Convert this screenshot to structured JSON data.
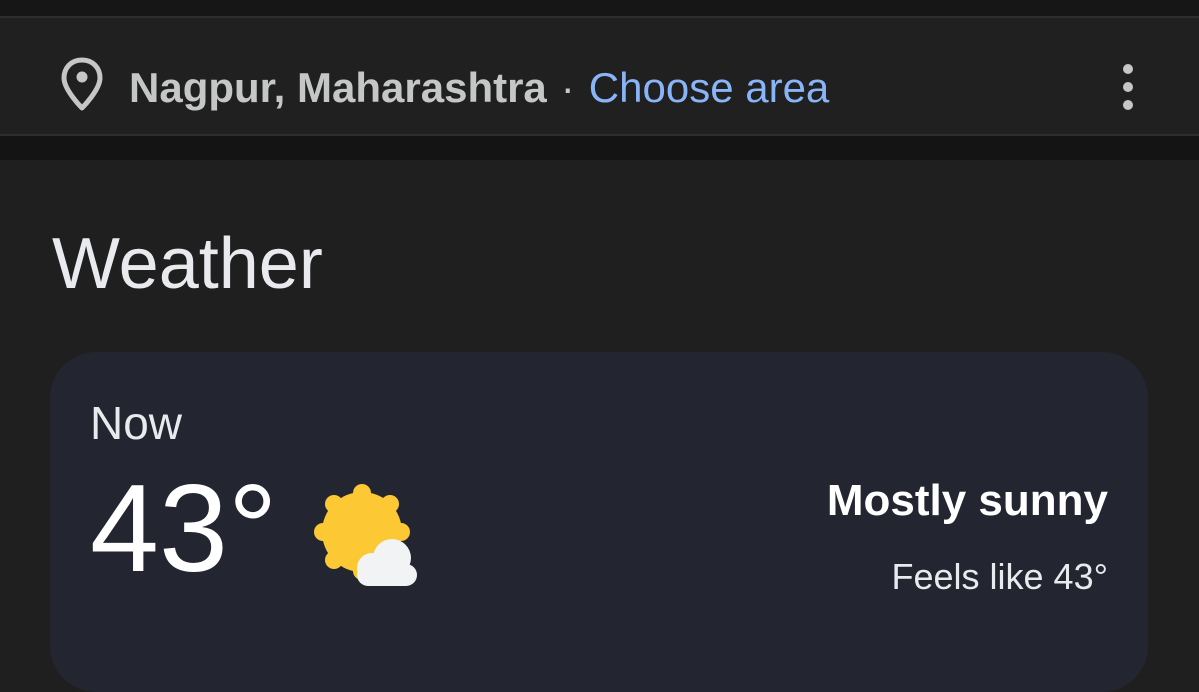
{
  "location_bar": {
    "location": "Nagpur, Maharashtra",
    "separator": "·",
    "choose_area_label": "Choose area",
    "pin_icon": "location-pin-icon",
    "more_icon": "more-vert-icon"
  },
  "weather": {
    "title": "Weather",
    "more_icon": "more-vert-icon",
    "now_label": "Now",
    "temperature": "43°",
    "condition": "Mostly sunny",
    "feels_like": "Feels like 43°",
    "condition_icon": "mostly-sunny-icon"
  },
  "colors": {
    "background": "#1f1f1f",
    "card": "#232631",
    "link": "#8ab4f8",
    "muted_text": "#c4c7c5",
    "sun": "#fcc934",
    "cloud": "#f1f3f4"
  }
}
